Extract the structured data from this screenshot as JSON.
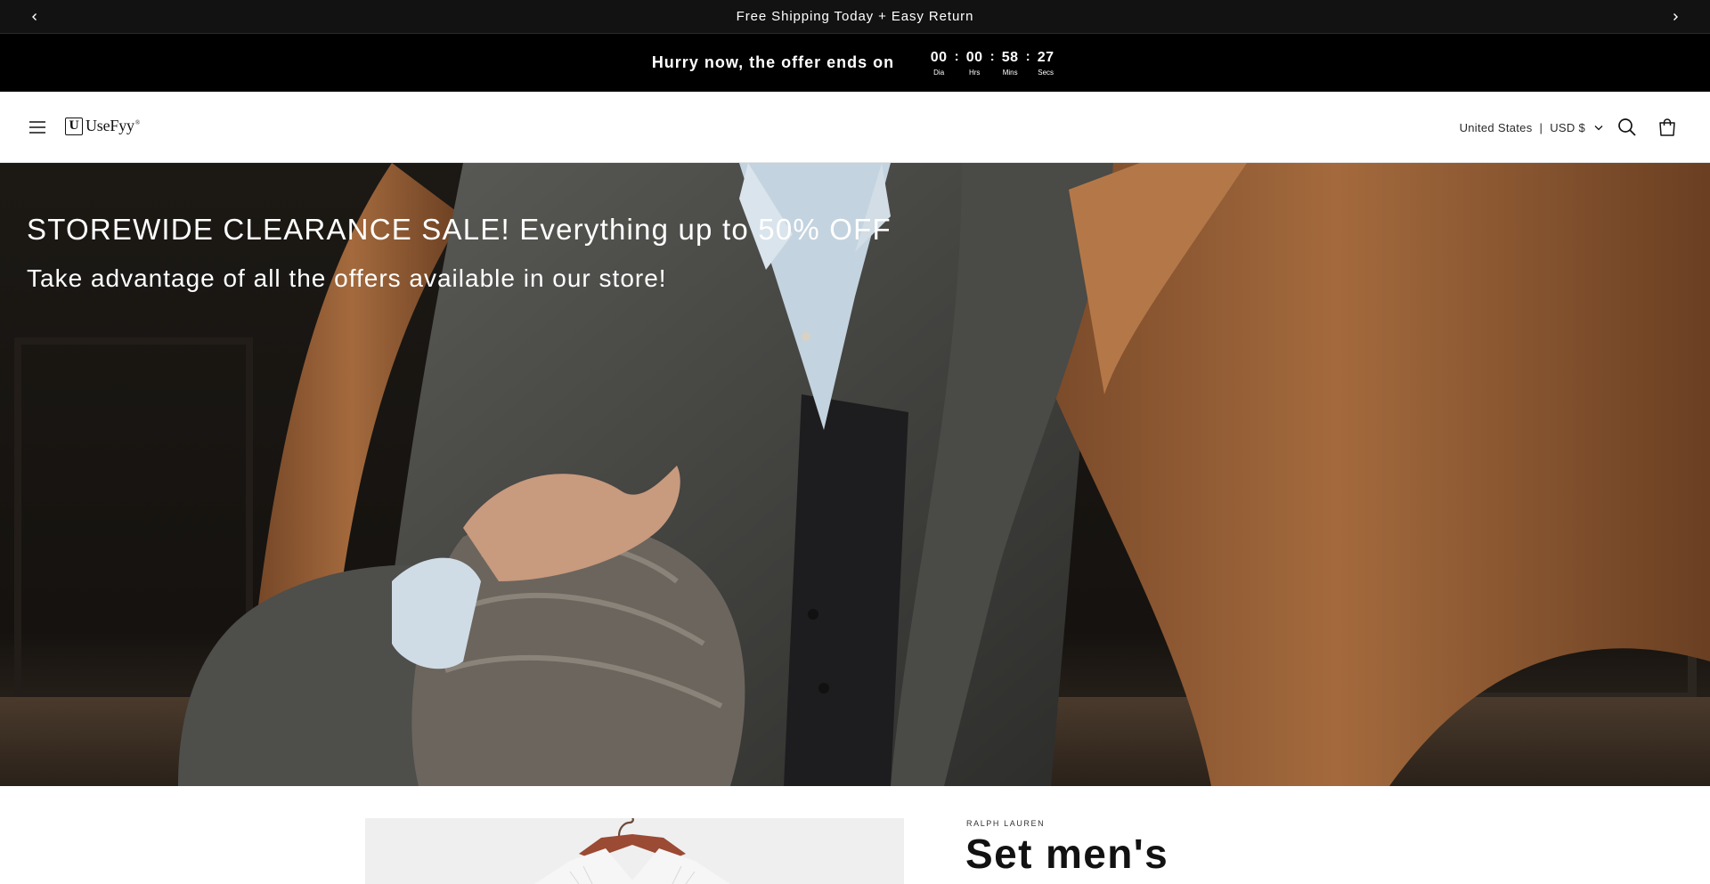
{
  "announcement": {
    "text": "Free Shipping Today + Easy Return",
    "prev_icon": "chevron-left-icon",
    "next_icon": "chevron-right-icon"
  },
  "countdown": {
    "message": "Hurry now, the offer ends on",
    "units": [
      {
        "value": "00",
        "label": "Dia"
      },
      {
        "value": "00",
        "label": "Hrs"
      },
      {
        "value": "58",
        "label": "Mins"
      },
      {
        "value": "27",
        "label": "Secs"
      }
    ],
    "separator": ":"
  },
  "header": {
    "logo_mark": "U",
    "logo_text": "UseFyy",
    "logo_tm": "®",
    "country": "United States",
    "divider": "|",
    "currency": "USD $",
    "icons": [
      "menu-icon",
      "search-icon",
      "cart-icon",
      "chevron-down-icon"
    ]
  },
  "hero": {
    "title": "STOREWIDE CLEARANCE SALE! Everything up to 50% OFF",
    "subtitle": "Take advantage of all the offers available in our store!"
  },
  "product": {
    "vendor": "RALPH LAUREN",
    "title": "Set men's"
  },
  "colors": {
    "announcement_bg": "#121212",
    "countdown_bg": "#000000",
    "text_primary": "#121212",
    "coat_brown": "#9a6238",
    "media_bg": "#efefef"
  }
}
